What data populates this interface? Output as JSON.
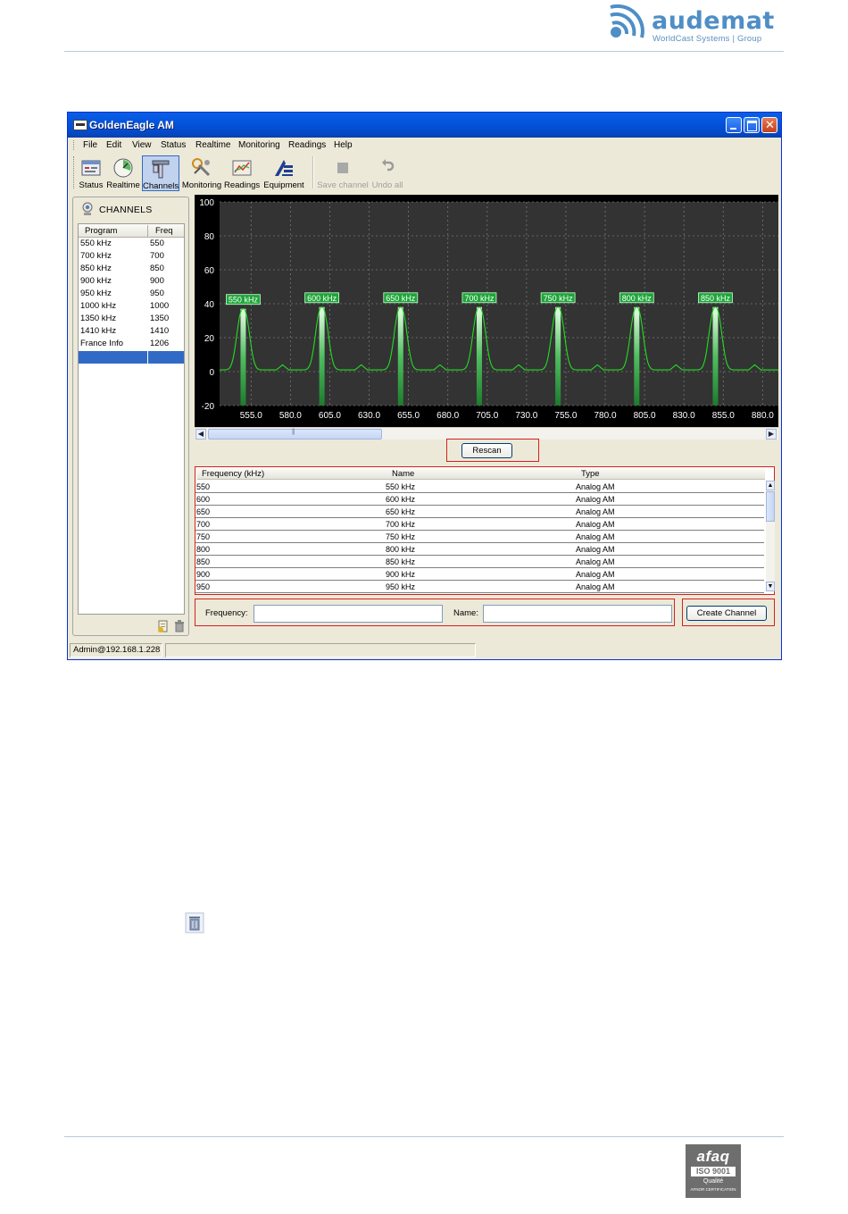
{
  "header": {
    "logo_word": "audemat",
    "logo_tagline": "WorldCast Systems | Group"
  },
  "window": {
    "title": "GoldenEagle AM",
    "menu": [
      "File",
      "Edit",
      "View",
      "Status",
      "Realtime",
      "Monitoring",
      "Readings",
      "Help"
    ],
    "toolbar": [
      {
        "label": "Status",
        "icon": "status-icon"
      },
      {
        "label": "Realtime",
        "icon": "realtime-icon"
      },
      {
        "label": "Channels",
        "icon": "channels-icon",
        "active": true
      },
      {
        "label": "Monitoring",
        "icon": "monitoring-icon"
      },
      {
        "label": "Readings",
        "icon": "readings-icon"
      },
      {
        "label": "Equipment",
        "icon": "equipment-icon"
      },
      {
        "label": "Save channel",
        "icon": "save-icon",
        "disabled": true
      },
      {
        "label": "Undo all",
        "icon": "undo-icon",
        "disabled": true
      }
    ]
  },
  "channels_panel": {
    "title": "CHANNELS",
    "columns": [
      "Program",
      "Freq"
    ],
    "rows": [
      {
        "program": "550 kHz",
        "freq": "550"
      },
      {
        "program": "700 kHz",
        "freq": "700"
      },
      {
        "program": "850 kHz",
        "freq": "850"
      },
      {
        "program": "900 kHz",
        "freq": "900"
      },
      {
        "program": "950 kHz",
        "freq": "950"
      },
      {
        "program": "1000 kHz",
        "freq": "1000"
      },
      {
        "program": "1350 kHz",
        "freq": "1350"
      },
      {
        "program": "1410 kHz",
        "freq": "1410"
      },
      {
        "program": "France Info",
        "freq": "1206"
      }
    ]
  },
  "chart_data": {
    "type": "line",
    "title": "",
    "xlabel": "",
    "ylabel": "",
    "ylim": [
      -20,
      100
    ],
    "y_ticks": [
      100,
      80,
      60,
      40,
      20,
      0,
      -20
    ],
    "x_ticks": [
      "555.0",
      "580.0",
      "605.0",
      "630.0",
      "655.0",
      "680.0",
      "705.0",
      "730.0",
      "755.0",
      "780.0",
      "805.0",
      "830.0",
      "855.0",
      "880.0"
    ],
    "xlim_visible": [
      535,
      890
    ],
    "grid": true,
    "background": "#333333",
    "line_color": "#22dd22",
    "peaks": [
      {
        "freq": 550,
        "level": 37,
        "label": "550 kHz"
      },
      {
        "freq": 600,
        "level": 38,
        "label": "600 kHz"
      },
      {
        "freq": 650,
        "level": 38,
        "label": "650 kHz"
      },
      {
        "freq": 700,
        "level": 38,
        "label": "700 kHz"
      },
      {
        "freq": 750,
        "level": 38,
        "label": "750 kHz"
      },
      {
        "freq": 800,
        "level": 38,
        "label": "800 kHz"
      },
      {
        "freq": 850,
        "level": 38,
        "label": "850 kHz"
      }
    ],
    "noise_floor": 1
  },
  "rescan_label": "Rescan",
  "freq_table": {
    "columns": [
      "Frequency (kHz)",
      "Name",
      "Type"
    ],
    "rows": [
      {
        "freq": "550",
        "name": "550 kHz",
        "type": "Analog AM"
      },
      {
        "freq": "600",
        "name": "600 kHz",
        "type": "Analog AM"
      },
      {
        "freq": "650",
        "name": "650 kHz",
        "type": "Analog AM"
      },
      {
        "freq": "700",
        "name": "700 kHz",
        "type": "Analog AM"
      },
      {
        "freq": "750",
        "name": "750 kHz",
        "type": "Analog AM"
      },
      {
        "freq": "800",
        "name": "800 kHz",
        "type": "Analog AM"
      },
      {
        "freq": "850",
        "name": "850 kHz",
        "type": "Analog AM"
      },
      {
        "freq": "900",
        "name": "900 kHz",
        "type": "Analog AM"
      },
      {
        "freq": "950",
        "name": "950 kHz",
        "type": "Analog AM"
      }
    ]
  },
  "create_form": {
    "frequency_label": "Frequency:",
    "frequency_value": "",
    "name_label": "Name:",
    "name_value": "",
    "create_button": "Create Channel"
  },
  "statusbar": {
    "user": "Admin@192.168.1.228",
    "message": ""
  },
  "footer": {
    "cert_brand": "afaq",
    "cert_standard": "ISO 9001",
    "cert_quality": "Qualité",
    "cert_body": "AFNOR CERTIFICATION"
  }
}
